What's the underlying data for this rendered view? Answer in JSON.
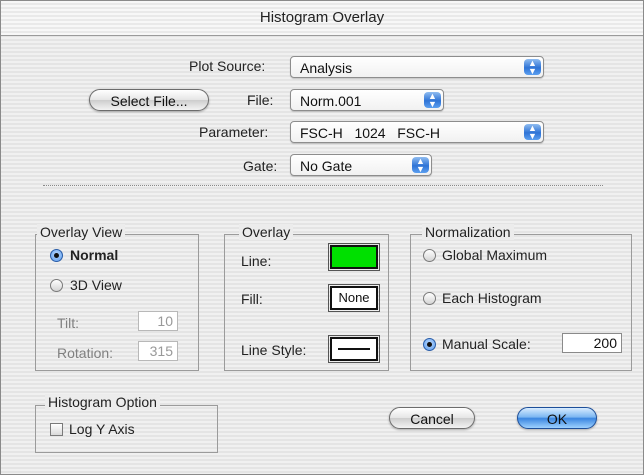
{
  "window": {
    "title": "Histogram Overlay"
  },
  "source": {
    "plot_source_label": "Plot Source:",
    "plot_source_value": "Analysis",
    "select_file_label": "Select File...",
    "file_label": "File:",
    "file_value": "Norm.001",
    "parameter_label": "Parameter:",
    "parameter_value": "FSC-H   1024   FSC-H",
    "gate_label": "Gate:",
    "gate_value": "No Gate"
  },
  "overlay_view": {
    "title": "Overlay View",
    "normal_label": "Normal",
    "normal_selected": true,
    "view3d_label": "3D View",
    "view3d_selected": false,
    "tilt_label": "Tilt:",
    "tilt_value": "10",
    "rotation_label": "Rotation:",
    "rotation_value": "315"
  },
  "overlay": {
    "title": "Overlay",
    "line_label": "Line:",
    "line_color": "#00e000",
    "fill_label": "Fill:",
    "fill_value": "None",
    "line_style_label": "Line Style:"
  },
  "normalization": {
    "title": "Normalization",
    "global_max_label": "Global Maximum",
    "each_hist_label": "Each Histogram",
    "manual_scale_label": "Manual Scale:",
    "manual_scale_value": "200",
    "selected": "Manual Scale"
  },
  "histogram_option": {
    "title": "Histogram Option",
    "log_y_label": "Log Y Axis",
    "log_y_checked": false
  },
  "buttons": {
    "cancel_label": "Cancel",
    "ok_label": "OK"
  },
  "colors": {
    "accent": "#3b86e0",
    "line_swatch": "#00e000"
  },
  "icons": {
    "popup_arrows": "updown-arrows-icon"
  }
}
